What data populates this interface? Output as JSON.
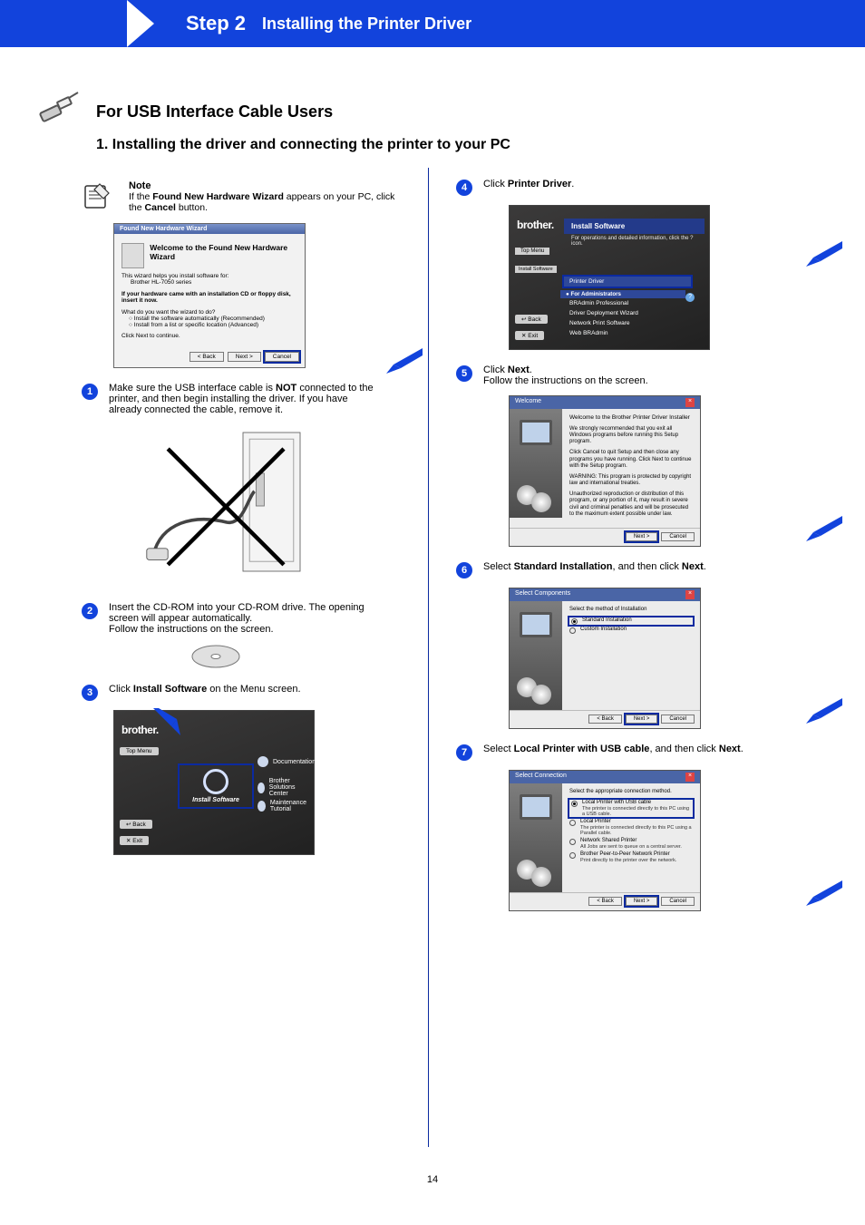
{
  "header": {
    "step": "Step 2",
    "title": "Installing the Printer Driver"
  },
  "section": {
    "title": "For USB Interface Cable Users",
    "subtitle": "1. Installing the driver and connecting the printer to your PC"
  },
  "note": {
    "heading": "Note",
    "line1": "If the ",
    "bold1": "Found New Hardware Wizard",
    "line2": " appears on your PC, click the ",
    "bold2": "Cancel",
    "line3": " button."
  },
  "dialog_fnh": {
    "title": "Found New Hardware Wizard",
    "welcome": "Welcome to the Found New Hardware Wizard",
    "sub": "This wizard helps you install software for:",
    "device": "Brother HL-7050 series",
    "hint": "If your hardware came with an installation CD or floppy disk, insert it now.",
    "q": "What do you want the wizard to do?",
    "r1": "Install the software automatically (Recommended)",
    "r2": "Install from a list or specific location (Advanced)",
    "cont": "Click Next to continue.",
    "back": "< Back",
    "next": "Next >",
    "cancel": "Cancel"
  },
  "steps": {
    "s1": {
      "p1": "Make sure the USB interface cable is ",
      "b1": "NOT",
      "p2": " connected to the printer, and then begin installing the driver. If you have already connected the cable, remove it."
    },
    "s2": {
      "p1": "Insert the CD-ROM into your CD-ROM drive. The opening screen will appear automatically.",
      "p2": "Follow the instructions on the screen."
    },
    "s3": {
      "p1": "Click ",
      "b1": "Install Software",
      "p2": " on the Menu screen."
    },
    "s4": {
      "p1": "Click ",
      "b1": "Printer Driver",
      "p2": "."
    },
    "s5": {
      "p1": "Click ",
      "b1": "Next",
      "p2": ".",
      "p3": "Follow the instructions on the screen."
    },
    "s6": {
      "p1": "Select ",
      "b1": "Standard Installation",
      "p2": ", and then click ",
      "b2": "Next",
      "p3": "."
    },
    "s7": {
      "p1": "Select ",
      "b1": "Local Printer with USB cable",
      "p2": ", and then click ",
      "b2": "Next",
      "p3": "."
    }
  },
  "bmenu1": {
    "brand": "brother.",
    "top_menu": "Top Menu",
    "main": "Install Software",
    "doc": "Documentation",
    "bsc": "Brother Solutions Center",
    "tut": "Maintenance Tutorial",
    "back": "↩ Back",
    "exit": "✕ Exit"
  },
  "bmenu2": {
    "brand": "brother.",
    "title": "Install Software",
    "sub": "For operations and detailed information, click the ? icon.",
    "pd": "Printer Driver",
    "admins": "● For Administrators",
    "a1": "BRAdmin Professional",
    "a2": "Driver Deployment Wizard",
    "a3": "Network Print Software",
    "a4": "Web BRAdmin",
    "top_menu": "Top Menu",
    "isw": "Install Software",
    "back": "↩ Back",
    "exit": "✕ Exit"
  },
  "wiz_welcome": {
    "title": "Welcome",
    "h": "Welcome to the Brother Printer Driver Installer",
    "p1": "We strongly recommended that you exit all Windows programs before running this Setup program.",
    "p2": "Click Cancel to quit Setup and then close any programs you have running. Click Next to continue with the Setup program.",
    "warn": "WARNING: This program is protected by copyright law and international treaties.",
    "warn2": "Unauthorized reproduction or distribution of this program, or any portion of it, may result in severe civil and criminal penalties and will be prosecuted to the maximum extent possible under law.",
    "next": "Next >",
    "cancel": "Cancel"
  },
  "wiz_components": {
    "title": "Select Components",
    "h": "Select the method of Installation",
    "r1": "Standard Installation",
    "r2": "Custom Installation",
    "back": "< Back",
    "next": "Next >",
    "cancel": "Cancel"
  },
  "wiz_connection": {
    "title": "Select Connection",
    "h": "Select the appropriate connection method.",
    "r1": "Local Printer with USB cable",
    "r1s": "The printer is connected directly to this PC using a USB cable.",
    "r2": "Local Printer",
    "r2s": "The printer is connected directly to this PC using a Parallel cable.",
    "r3": "Network Shared Printer",
    "r3s": "All Jobs are sent to queue on a central server.",
    "r4": "Brother Peer-to-Peer Network Printer",
    "r4s": "Print directly to the printer over the network.",
    "back": "< Back",
    "next": "Next >",
    "cancel": "Cancel"
  },
  "page_number": "14"
}
